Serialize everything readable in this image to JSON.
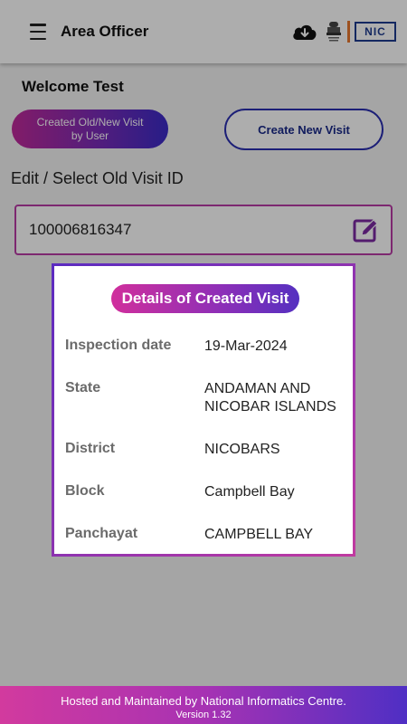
{
  "app_bar": {
    "title": "Area Officer",
    "nic_logo_text": "NIC",
    "icons": [
      "menu-icon",
      "cloud-download-icon",
      "emblem-icon",
      "nic-logo"
    ]
  },
  "main": {
    "welcome": "Welcome Test",
    "btn_old_visit_line1": "Created Old/New Visit",
    "btn_old_visit_line2": "by User",
    "btn_new_visit": "Create New Visit",
    "select_label": "Edit / Select Old Visit ID",
    "visit_id": "100006816347"
  },
  "dialog": {
    "title": "Details of Created Visit",
    "rows": [
      {
        "label": "Inspection date",
        "value": "19-Mar-2024"
      },
      {
        "label": "State",
        "value": "ANDAMAN AND NICOBAR ISLANDS"
      },
      {
        "label": "District",
        "value": "NICOBARS"
      },
      {
        "label": "Block",
        "value": "Campbell Bay"
      },
      {
        "label": "Panchayat",
        "value": "CAMPBELL BAY"
      }
    ]
  },
  "footer": {
    "hosted": "Hosted and Maintained by National Informatics Centre.",
    "version": "Version 1.32"
  },
  "colors": {
    "accent_pink": "#c02a9a",
    "accent_purple": "#5530c0",
    "nic_blue": "#1e3b8f"
  }
}
